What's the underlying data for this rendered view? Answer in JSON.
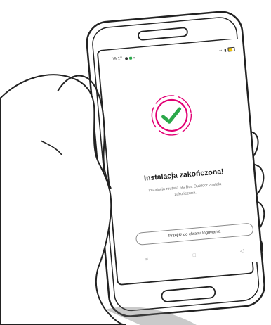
{
  "status_bar": {
    "time": "09:17"
  },
  "success": {
    "icon": "check-circle-icon",
    "accent_color": "#e20074",
    "check_color": "#2ba84a"
  },
  "heading": "Instalacja zakończona!",
  "description": {
    "line1": "Instalacja routera 5G Box Outdoor została",
    "line2": "zakończona."
  },
  "login_button": {
    "label": "Przejdź do ekranu logowania"
  },
  "nav_bar": {
    "recents_icon": "recents-icon",
    "home_icon": "home-icon",
    "back_icon": "back-icon"
  }
}
